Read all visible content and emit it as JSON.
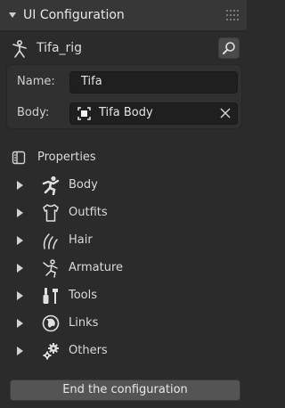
{
  "panel": {
    "title": "UI Configuration",
    "collapse_icon": "caret-down-icon",
    "grip_icon": "drag-grip-icon"
  },
  "rig": {
    "name": "Tifa_rig",
    "icon": "armature-icon",
    "search_icon": "eyedropper-search-icon"
  },
  "form": {
    "name_label": "Name:",
    "name_value": "Tifa",
    "body_label": "Body:",
    "body_value": "Tifa Body",
    "body_icon": "object-icon",
    "clear_icon": "close-icon"
  },
  "properties": {
    "label": "Properties",
    "icon": "properties-icon"
  },
  "sections": [
    {
      "label": "Body",
      "icon": "body-pose-icon"
    },
    {
      "label": "Outfits",
      "icon": "shirt-icon"
    },
    {
      "label": "Hair",
      "icon": "hair-icon"
    },
    {
      "label": "Armature",
      "icon": "armature-icon"
    },
    {
      "label": "Tools",
      "icon": "tools-icon"
    },
    {
      "label": "Links",
      "icon": "links-globe-icon"
    },
    {
      "label": "Others",
      "icon": "gears-icon"
    }
  ],
  "footer": {
    "end_label": "End the configuration"
  },
  "colors": {
    "background": "#2b2b2b",
    "header": "#373737",
    "field": "#1f1f1f",
    "button": "#545454",
    "text": "#d6d6d6"
  }
}
